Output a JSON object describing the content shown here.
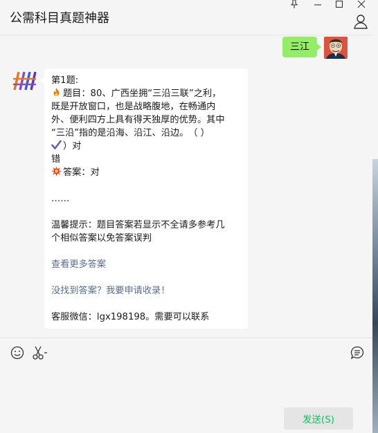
{
  "window": {
    "title": "公需科目真题神器",
    "controls": [
      "pin-icon",
      "minimize-icon",
      "maximize-icon",
      "close-icon"
    ]
  },
  "header": {
    "profile_icon": "person-icon"
  },
  "messages": {
    "outgoing": {
      "text": "三江",
      "avatar_icon": "cartoon-avatar"
    },
    "incoming": {
      "avatar_icon": "bot-logo",
      "lines": {
        "q_label": "第1题:",
        "q_line1": "题目：80、广西坐拥“三沿三联”之利，",
        "q_line2": "既是开放窗口，也是战略腹地，在畅通内",
        "q_line3": "外、便利四方上具有得天独厚的优势。其中",
        "q_line4": "“三沿”指的是沿海、沿江、沿边。　（  ）",
        "opt_true": "）对",
        "opt_false": "错",
        "answer": "答案：对",
        "ellipsis": "……",
        "tip_line1": "温馨提示：题目答案若显示不全请多参考几",
        "tip_line2": "个相似答案以免答案误判",
        "link_more": "查看更多答案",
        "link_request": "没找到答案？我要申请收录！",
        "contact": "客服微信：lgx198198。需要可以联系"
      },
      "emoji_icons": [
        "fire-icon",
        "check-mark-icon",
        "burst-icon"
      ]
    }
  },
  "input": {
    "tools": [
      "emoji-icon",
      "scissors-icon",
      "chat-history-icon"
    ],
    "send_label": "发送(S)"
  },
  "colors": {
    "my_bubble": "#95ec69",
    "send_text": "#07c160",
    "link": "#5a6f8f"
  }
}
